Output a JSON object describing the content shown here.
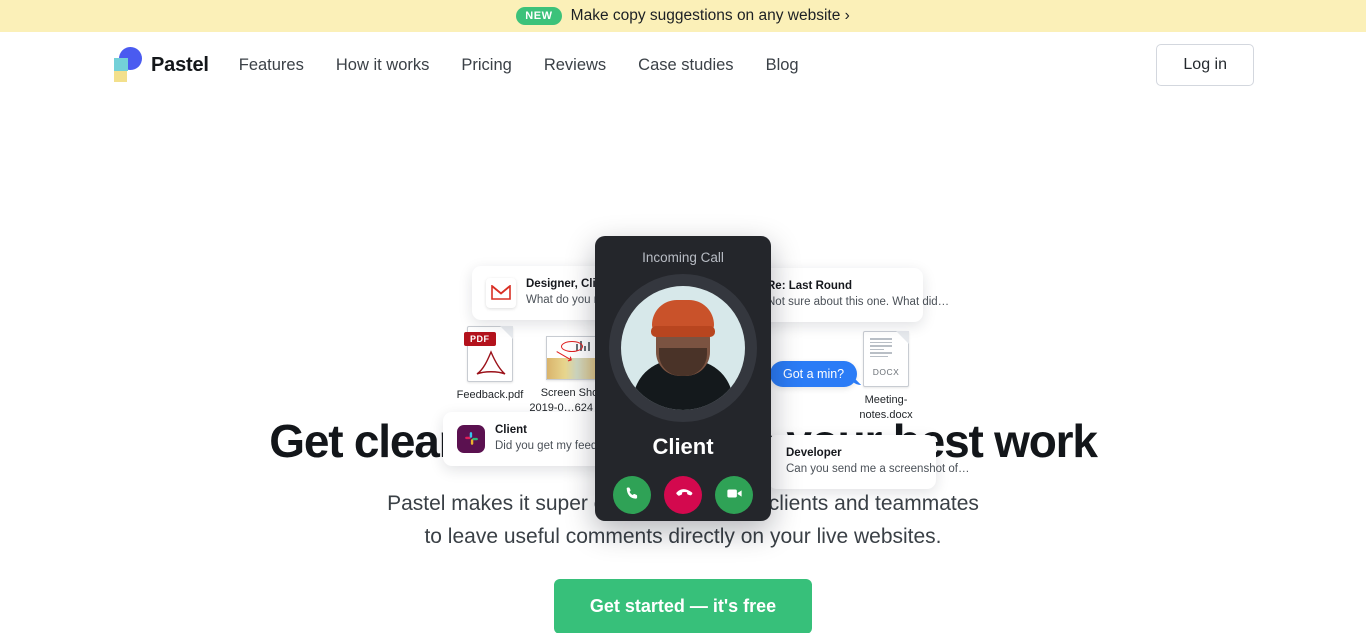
{
  "banner": {
    "badge": "NEW",
    "text": "Make copy suggestions on any website ›"
  },
  "header": {
    "brand": "Pastel",
    "nav": [
      {
        "label": "Features"
      },
      {
        "label": "How it works"
      },
      {
        "label": "Pricing"
      },
      {
        "label": "Reviews"
      },
      {
        "label": "Case studies"
      },
      {
        "label": "Blog"
      }
    ],
    "login_label": "Log in"
  },
  "hero_art": {
    "gmail_card": {
      "title": "Designer, Client +3",
      "body": "What do you mean"
    },
    "reply_card": {
      "title": "Re: Last Round",
      "body": "Not sure about this one. What did…"
    },
    "slack_card": {
      "title": "Client",
      "body": "Did you get my feedback no"
    },
    "dev_card": {
      "title": "Developer",
      "body": "Can you send me a screenshot of…"
    },
    "files": [
      {
        "name": "Feedback.pdf",
        "kind": "PDF"
      },
      {
        "name": "Screen Shot\n2019-0…624 PM",
        "line1": "Screen Shot",
        "line2": "2019-0…624 PM",
        "kind": "image"
      },
      {
        "name": "Meeting-notes.docx",
        "line1": "Meeting-",
        "line2": "notes.docx",
        "kind": "DOCX"
      }
    ],
    "bubble": "Got a min?",
    "call": {
      "title": "Incoming Call",
      "caller": "Client",
      "accept_label": "Accept call",
      "decline_label": "Decline call",
      "video_label": "Video call"
    }
  },
  "hero": {
    "headline": "Get clear feedback to do your best work",
    "subhead_line1": "Pastel makes it super easy to invite your clients and teammates",
    "subhead_line2": "to leave useful comments directly on your live websites.",
    "cta_label": "Get started — it's free"
  },
  "colors": {
    "banner_bg": "#fbf0b8",
    "badge_green": "#3cc27a",
    "cta_green": "#37c07a",
    "brand_blue": "#4a5bf0",
    "brand_teal": "#73d0d8",
    "brand_yellow": "#f3e08c",
    "call_card_bg": "#24262b",
    "decline_red": "#d3094e",
    "accept_green": "#2fa256",
    "bubble_blue": "#2b7cf6"
  }
}
